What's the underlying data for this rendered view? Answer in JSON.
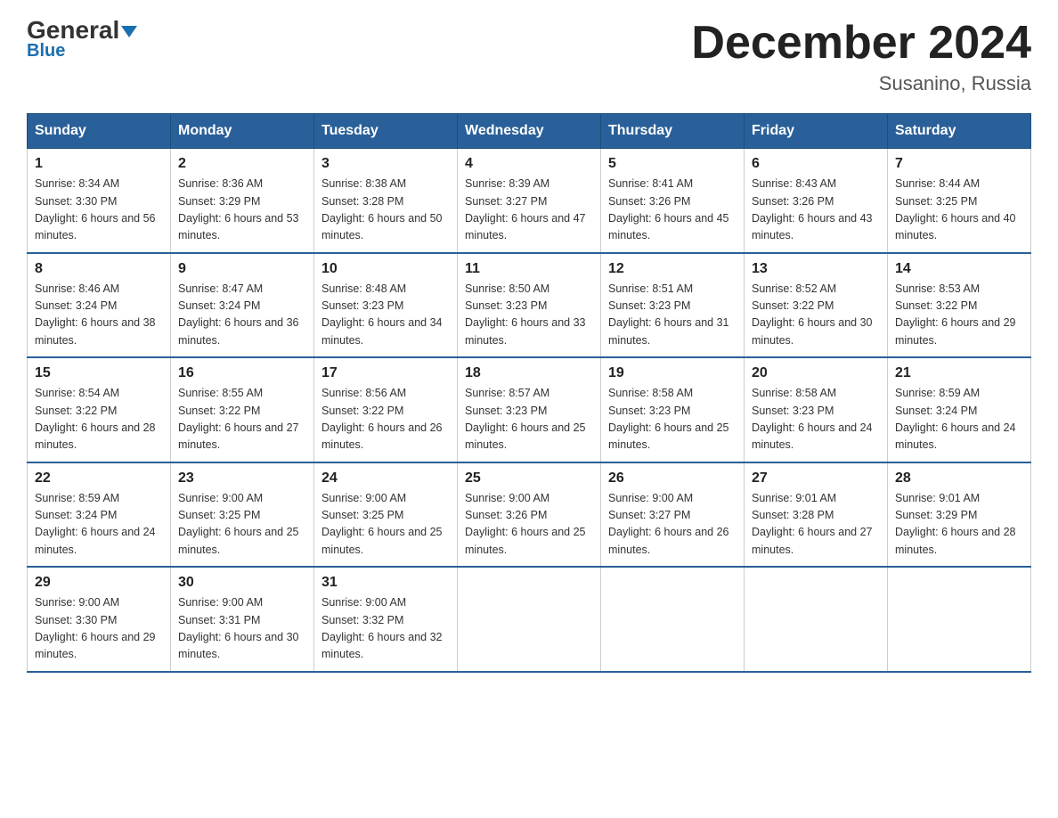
{
  "header": {
    "logo_general": "General",
    "logo_blue": "Blue",
    "title": "December 2024",
    "subtitle": "Susanino, Russia"
  },
  "days_of_week": [
    "Sunday",
    "Monday",
    "Tuesday",
    "Wednesday",
    "Thursday",
    "Friday",
    "Saturday"
  ],
  "weeks": [
    [
      {
        "day": "1",
        "sunrise": "8:34 AM",
        "sunset": "3:30 PM",
        "daylight": "6 hours and 56 minutes."
      },
      {
        "day": "2",
        "sunrise": "8:36 AM",
        "sunset": "3:29 PM",
        "daylight": "6 hours and 53 minutes."
      },
      {
        "day": "3",
        "sunrise": "8:38 AM",
        "sunset": "3:28 PM",
        "daylight": "6 hours and 50 minutes."
      },
      {
        "day": "4",
        "sunrise": "8:39 AM",
        "sunset": "3:27 PM",
        "daylight": "6 hours and 47 minutes."
      },
      {
        "day": "5",
        "sunrise": "8:41 AM",
        "sunset": "3:26 PM",
        "daylight": "6 hours and 45 minutes."
      },
      {
        "day": "6",
        "sunrise": "8:43 AM",
        "sunset": "3:26 PM",
        "daylight": "6 hours and 43 minutes."
      },
      {
        "day": "7",
        "sunrise": "8:44 AM",
        "sunset": "3:25 PM",
        "daylight": "6 hours and 40 minutes."
      }
    ],
    [
      {
        "day": "8",
        "sunrise": "8:46 AM",
        "sunset": "3:24 PM",
        "daylight": "6 hours and 38 minutes."
      },
      {
        "day": "9",
        "sunrise": "8:47 AM",
        "sunset": "3:24 PM",
        "daylight": "6 hours and 36 minutes."
      },
      {
        "day": "10",
        "sunrise": "8:48 AM",
        "sunset": "3:23 PM",
        "daylight": "6 hours and 34 minutes."
      },
      {
        "day": "11",
        "sunrise": "8:50 AM",
        "sunset": "3:23 PM",
        "daylight": "6 hours and 33 minutes."
      },
      {
        "day": "12",
        "sunrise": "8:51 AM",
        "sunset": "3:23 PM",
        "daylight": "6 hours and 31 minutes."
      },
      {
        "day": "13",
        "sunrise": "8:52 AM",
        "sunset": "3:22 PM",
        "daylight": "6 hours and 30 minutes."
      },
      {
        "day": "14",
        "sunrise": "8:53 AM",
        "sunset": "3:22 PM",
        "daylight": "6 hours and 29 minutes."
      }
    ],
    [
      {
        "day": "15",
        "sunrise": "8:54 AM",
        "sunset": "3:22 PM",
        "daylight": "6 hours and 28 minutes."
      },
      {
        "day": "16",
        "sunrise": "8:55 AM",
        "sunset": "3:22 PM",
        "daylight": "6 hours and 27 minutes."
      },
      {
        "day": "17",
        "sunrise": "8:56 AM",
        "sunset": "3:22 PM",
        "daylight": "6 hours and 26 minutes."
      },
      {
        "day": "18",
        "sunrise": "8:57 AM",
        "sunset": "3:23 PM",
        "daylight": "6 hours and 25 minutes."
      },
      {
        "day": "19",
        "sunrise": "8:58 AM",
        "sunset": "3:23 PM",
        "daylight": "6 hours and 25 minutes."
      },
      {
        "day": "20",
        "sunrise": "8:58 AM",
        "sunset": "3:23 PM",
        "daylight": "6 hours and 24 minutes."
      },
      {
        "day": "21",
        "sunrise": "8:59 AM",
        "sunset": "3:24 PM",
        "daylight": "6 hours and 24 minutes."
      }
    ],
    [
      {
        "day": "22",
        "sunrise": "8:59 AM",
        "sunset": "3:24 PM",
        "daylight": "6 hours and 24 minutes."
      },
      {
        "day": "23",
        "sunrise": "9:00 AM",
        "sunset": "3:25 PM",
        "daylight": "6 hours and 25 minutes."
      },
      {
        "day": "24",
        "sunrise": "9:00 AM",
        "sunset": "3:25 PM",
        "daylight": "6 hours and 25 minutes."
      },
      {
        "day": "25",
        "sunrise": "9:00 AM",
        "sunset": "3:26 PM",
        "daylight": "6 hours and 25 minutes."
      },
      {
        "day": "26",
        "sunrise": "9:00 AM",
        "sunset": "3:27 PM",
        "daylight": "6 hours and 26 minutes."
      },
      {
        "day": "27",
        "sunrise": "9:01 AM",
        "sunset": "3:28 PM",
        "daylight": "6 hours and 27 minutes."
      },
      {
        "day": "28",
        "sunrise": "9:01 AM",
        "sunset": "3:29 PM",
        "daylight": "6 hours and 28 minutes."
      }
    ],
    [
      {
        "day": "29",
        "sunrise": "9:00 AM",
        "sunset": "3:30 PM",
        "daylight": "6 hours and 29 minutes."
      },
      {
        "day": "30",
        "sunrise": "9:00 AM",
        "sunset": "3:31 PM",
        "daylight": "6 hours and 30 minutes."
      },
      {
        "day": "31",
        "sunrise": "9:00 AM",
        "sunset": "3:32 PM",
        "daylight": "6 hours and 32 minutes."
      },
      null,
      null,
      null,
      null
    ]
  ]
}
